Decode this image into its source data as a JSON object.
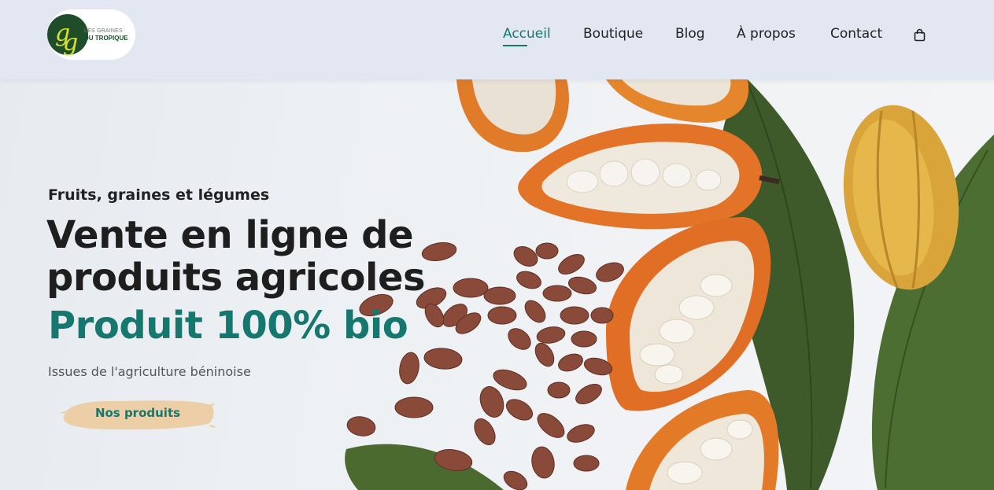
{
  "brand": {
    "logo_line1": "LES GRAINES",
    "logo_line2": "DU TROPIQUE",
    "logo_letters": "gg"
  },
  "nav": {
    "items": [
      {
        "label": "Accueil",
        "active": true
      },
      {
        "label": "Boutique",
        "active": false
      },
      {
        "label": "Blog",
        "active": false
      },
      {
        "label": "À propos",
        "active": false
      },
      {
        "label": "Contact",
        "active": false
      }
    ],
    "cart_icon": "shopping-bag-icon"
  },
  "hero": {
    "subtitle": "Fruits, graines et légumes",
    "headline_line1": "Vente en ligne de",
    "headline_line2": "produits agricoles",
    "headline_accent": "Produit 100% bio",
    "tagline": "Issues de l'agriculture béninoise",
    "cta_label": "Nos produits"
  },
  "colors": {
    "accent": "#16776f",
    "header_bg": "#e3e7f2",
    "cta_brush": "#eccfa6",
    "text_dark": "#1e1e1e"
  }
}
